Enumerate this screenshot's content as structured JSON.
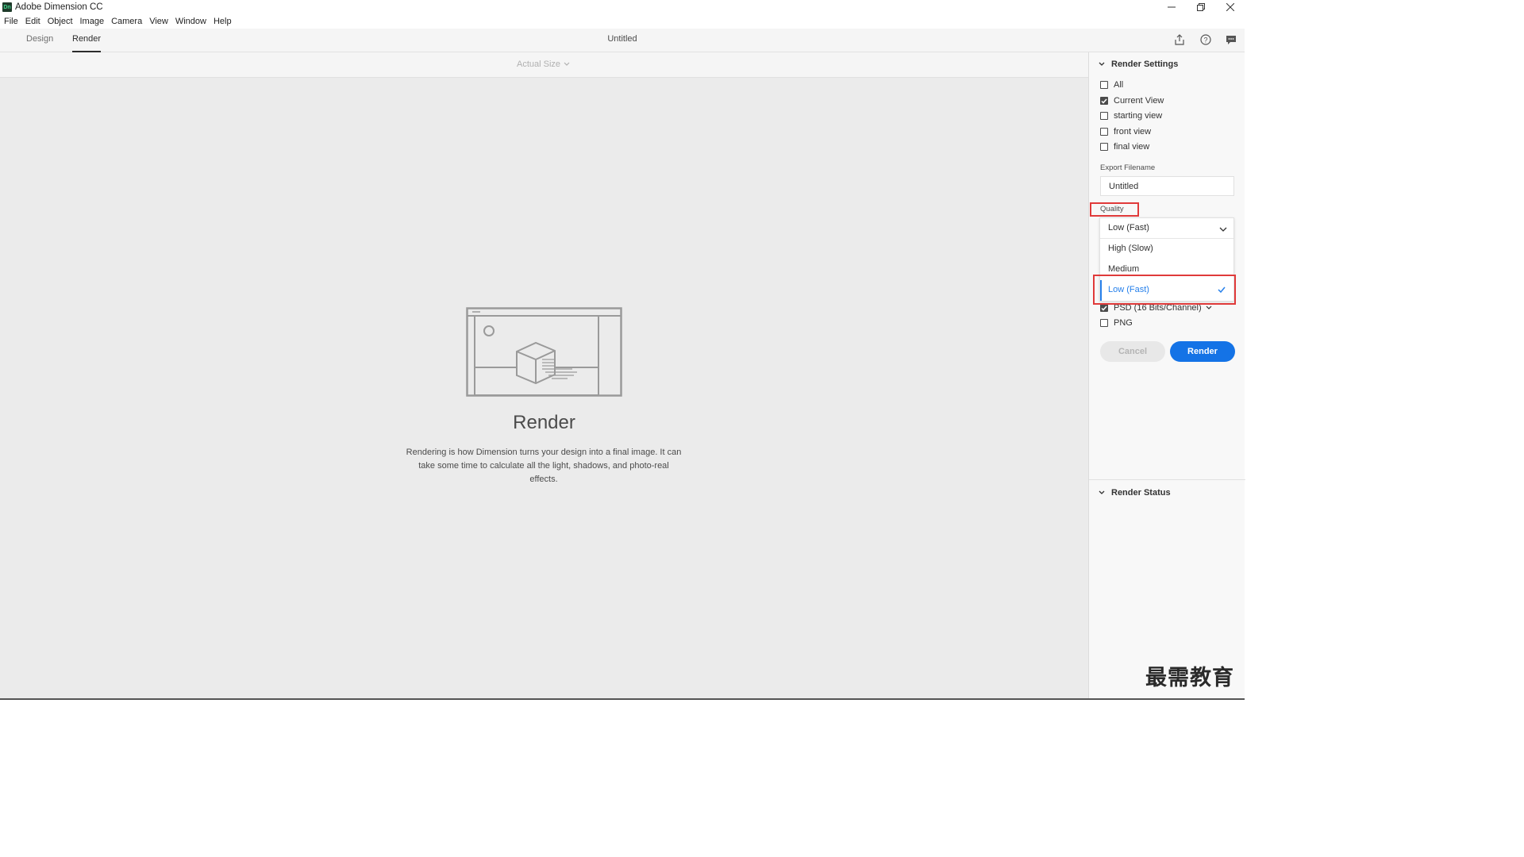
{
  "window": {
    "app_icon_text": "Dn",
    "title": "Adobe Dimension CC",
    "controls": [
      "minimize-icon",
      "restore-icon",
      "close-icon"
    ]
  },
  "menu": [
    "File",
    "Edit",
    "Object",
    "Image",
    "Camera",
    "View",
    "Window",
    "Help"
  ],
  "header": {
    "tabs": [
      "Design",
      "Render"
    ],
    "active_tab": "Render",
    "document_title": "Untitled",
    "icons": [
      "share-icon",
      "help-icon",
      "feedback-icon"
    ]
  },
  "canvas": {
    "zoom_label": "Actual Size",
    "heading": "Render",
    "description": "Rendering is how Dimension turns your design into a final image. It can take some time to calculate all the light, shadows, and photo-real effects."
  },
  "render_settings": {
    "title": "Render Settings",
    "views": [
      {
        "label": "All",
        "checked": false
      },
      {
        "label": "Current View",
        "checked": true
      },
      {
        "label": "starting view",
        "checked": false
      },
      {
        "label": "front view",
        "checked": false
      },
      {
        "label": "final view",
        "checked": false
      }
    ],
    "export_filename_label": "Export Filename",
    "export_filename_value": "Untitled",
    "quality_label": "Quality",
    "quality_selected": "Low (Fast)",
    "quality_options": [
      "High (Slow)",
      "Medium",
      "Low (Fast)"
    ],
    "quality_active": "Low (Fast)",
    "formats": [
      {
        "label": "PSD (16 Bits/Channel)",
        "checked": true
      },
      {
        "label": "PNG",
        "checked": false
      }
    ],
    "cancel_label": "Cancel",
    "render_label": "Render"
  },
  "render_status": {
    "title": "Render Status"
  },
  "watermark": "最需教育",
  "colors": {
    "accent": "#1473e6",
    "highlight_outline": "#e03a3a",
    "canvas_bg": "#ebebeb"
  }
}
